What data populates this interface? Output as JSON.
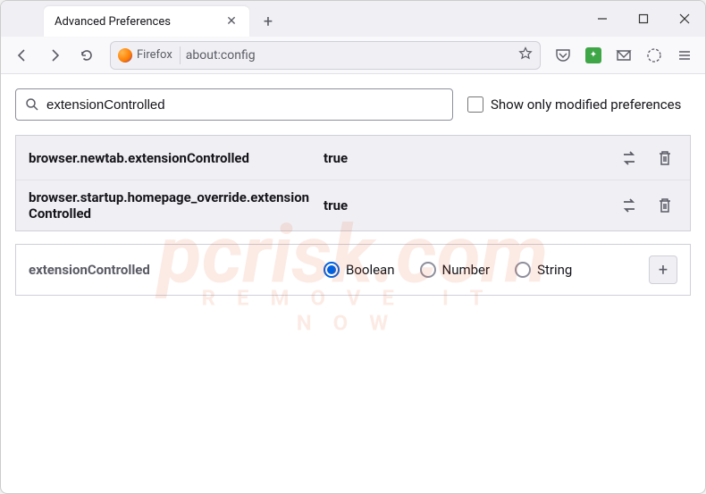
{
  "tab": {
    "title": "Advanced Preferences"
  },
  "urlbar": {
    "identity": "Firefox",
    "url": "about:config"
  },
  "search": {
    "value": "extensionControlled",
    "checkbox_label": "Show only modified preferences"
  },
  "prefs": [
    {
      "name": "browser.newtab.extensionControlled",
      "value": "true"
    },
    {
      "name": "browser.startup.homepage_override.extensionControlled",
      "value": "true"
    }
  ],
  "create": {
    "name": "extensionControlled",
    "types": [
      "Boolean",
      "Number",
      "String"
    ],
    "selected": "Boolean"
  },
  "watermark": {
    "main": "pcrisk",
    "suffix": ".com",
    "sub": "REMOVE IT NOW"
  }
}
